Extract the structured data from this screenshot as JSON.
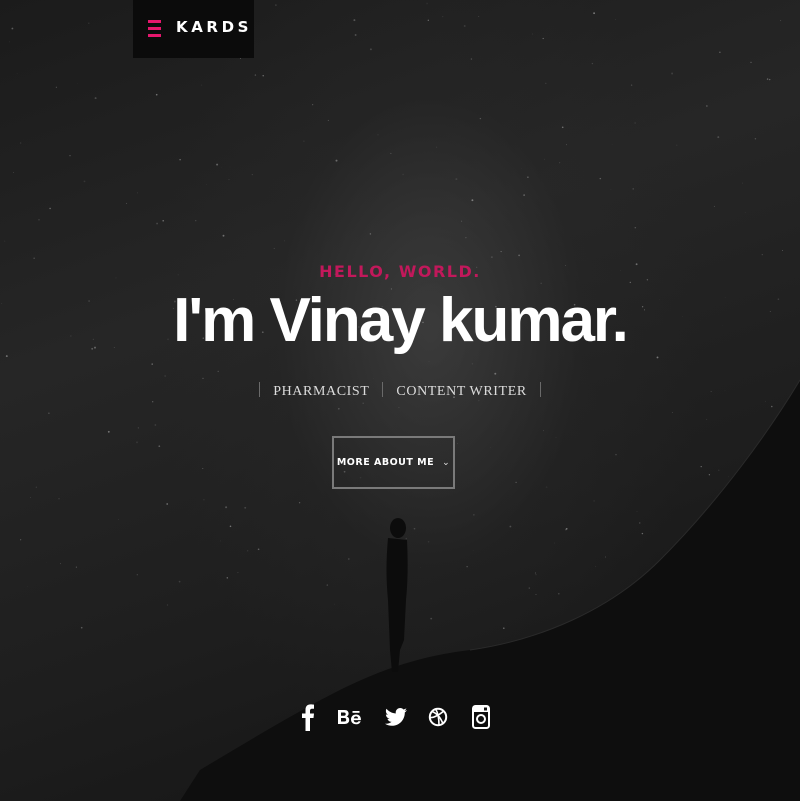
{
  "header": {
    "logo_text": "KARDS",
    "accent_color": "#e5176d"
  },
  "intro": {
    "greeting": "HELLO, WORLD.",
    "headline": "I'm Vinay kumar.",
    "roles": [
      "PHARMACIST",
      "CONTENT WRITER"
    ],
    "cta_label": "MORE ABOUT ME",
    "cta_icon": "chevron-down-icon"
  },
  "social": {
    "items": [
      {
        "name": "facebook",
        "icon": "facebook-icon"
      },
      {
        "name": "behance",
        "icon": "behance-icon"
      },
      {
        "name": "twitter",
        "icon": "twitter-icon"
      },
      {
        "name": "dribbble",
        "icon": "dribbble-icon"
      },
      {
        "name": "instagram",
        "icon": "instagram-icon"
      }
    ]
  },
  "colors": {
    "background": "#141414",
    "greeting": "#c2185b",
    "text": "#ffffff"
  }
}
